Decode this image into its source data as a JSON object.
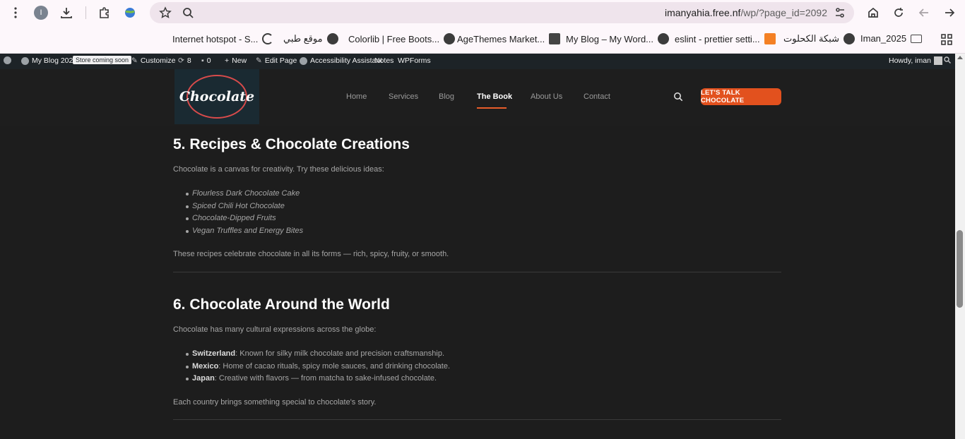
{
  "browser": {
    "profile_initial": "I",
    "url_host": "imanyahia.free.nf",
    "url_path": "/wp/?page_id=2092",
    "icons": [
      "menu-icon",
      "profile-avatar",
      "download-icon",
      "extensions-icon",
      "globe-extension-icon",
      "star-icon",
      "site-info-icon",
      "tune-icon",
      "home-icon",
      "reload-icon",
      "back-icon",
      "forward-icon",
      "apps-grid-icon"
    ]
  },
  "bookmarks": [
    {
      "label": "Internet hotspot - S..."
    },
    {
      "label": "موقع طبي"
    },
    {
      "label": "Colorlib | Free Boots..."
    },
    {
      "label": "AgeThemes Market..."
    },
    {
      "label": "My Blog – My Word..."
    },
    {
      "label": "eslint - prettier setti..."
    },
    {
      "label": "شبكة الكحلوت"
    },
    {
      "label": "Iman_2025"
    }
  ],
  "adminbar": {
    "site": "My Blog 2025",
    "badge": "Store coming soon",
    "customize": "Customize",
    "updates": "8",
    "comments": "0",
    "new": "New",
    "edit": "Edit Page",
    "accessibility": "Accessibility Assistant",
    "notes": "Notes",
    "wpforms": "WPForms",
    "howdy": "Howdy, iman"
  },
  "header": {
    "logo_text": "Chocolate",
    "nav": [
      "Home",
      "Services",
      "Blog",
      "The Book",
      "About Us",
      "Contact"
    ],
    "active_nav": "The Book",
    "cta": "LET'S TALK CHOCOLATE",
    "accent": "#e2511e"
  },
  "sections": [
    {
      "heading": "5. Recipes & Chocolate Creations",
      "intro": "Chocolate is a canvas for creativity. Try these delicious ideas:",
      "items": [
        "Flourless Dark Chocolate Cake",
        "Spiced Chili Hot Chocolate",
        "Chocolate-Dipped Fruits",
        "Vegan Truffles and Energy Bites"
      ],
      "outro": "These recipes celebrate chocolate in all its forms — rich, spicy, fruity, or smooth."
    },
    {
      "heading": "6. Chocolate Around the World",
      "intro": "Chocolate has many cultural expressions across the globe:",
      "items": [
        {
          "term": "Switzerland",
          "desc": ": Known for silky milk chocolate and precision craftsmanship."
        },
        {
          "term": "Mexico",
          "desc": ": Home of cacao rituals, spicy mole sauces, and drinking chocolate."
        },
        {
          "term": "Japan",
          "desc": ": Creative with flavors — from matcha to sake-infused chocolate."
        }
      ],
      "outro": "Each country brings something special to chocolate's story."
    }
  ]
}
